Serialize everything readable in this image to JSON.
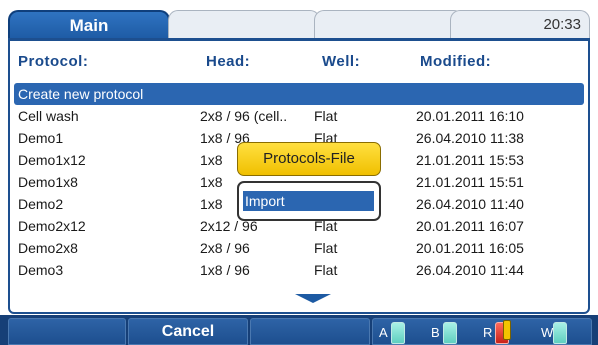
{
  "tabs": {
    "active_label": "Main",
    "clock": "20:33"
  },
  "columns": {
    "protocol": "Protocol:",
    "head": "Head:",
    "well": "Well:",
    "modified": "Modified:"
  },
  "rows": [
    {
      "protocol": "Create new protocol",
      "head": "",
      "well": "",
      "modified": "",
      "selected": true
    },
    {
      "protocol": "Cell wash",
      "head": "2x8 / 96 (cell..",
      "well": "Flat",
      "modified": "20.01.2011 16:10"
    },
    {
      "protocol": "Demo1",
      "head": "1x8 / 96",
      "well": "Flat",
      "modified": "26.04.2010 11:38"
    },
    {
      "protocol": "Demo1x12",
      "head": "1x8",
      "well": "",
      "modified": "21.01.2011 15:53"
    },
    {
      "protocol": "Demo1x8",
      "head": "1x8",
      "well": "",
      "modified": "21.01.2011 15:51"
    },
    {
      "protocol": "Demo2",
      "head": "1x8",
      "well": "",
      "modified": "26.04.2010 11:40"
    },
    {
      "protocol": "Demo2x12",
      "head": "2x12 / 96",
      "well": "Flat",
      "modified": "20.01.2011 16:07"
    },
    {
      "protocol": "Demo2x8",
      "head": "2x8 / 96",
      "well": "Flat",
      "modified": "20.01.2011 16:05"
    },
    {
      "protocol": "Demo3",
      "head": "1x8 / 96",
      "well": "Flat",
      "modified": "26.04.2010 11:44"
    }
  ],
  "popup": {
    "title": "Protocols-File",
    "item": "Import"
  },
  "bottom": {
    "cancel_label": "Cancel",
    "bottles": [
      {
        "label": "A",
        "color": "#7fe0d4",
        "alert": false
      },
      {
        "label": "B",
        "color": "#7fe0d4",
        "alert": false
      },
      {
        "label": "R",
        "color": "#e0322a",
        "alert": true
      },
      {
        "label": "W",
        "color": "#7fe0d4",
        "alert": false
      }
    ]
  }
}
